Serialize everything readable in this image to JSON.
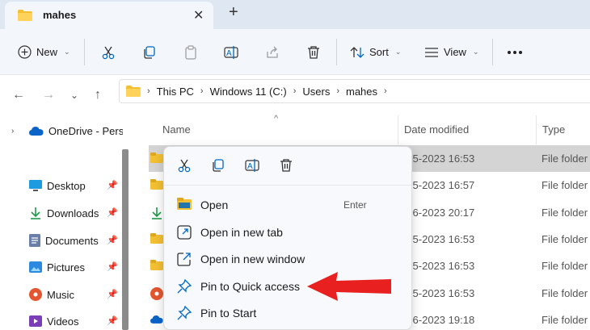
{
  "tab": {
    "title": "mahes",
    "close_icon": "close-icon",
    "new_tab_icon": "plus-icon"
  },
  "toolbar": {
    "new_label": "New",
    "sort_label": "Sort",
    "view_label": "View",
    "more_icon": "more-icon"
  },
  "address": {
    "crumbs": [
      "This PC",
      "Windows 11 (C:)",
      "Users",
      "mahes"
    ]
  },
  "sidebar": {
    "onedrive": "OneDrive - Perso",
    "items": [
      {
        "label": "Desktop",
        "icon": "desktop-icon"
      },
      {
        "label": "Downloads",
        "icon": "download-icon"
      },
      {
        "label": "Documents",
        "icon": "documents-icon"
      },
      {
        "label": "Pictures",
        "icon": "pictures-icon"
      },
      {
        "label": "Music",
        "icon": "music-icon"
      },
      {
        "label": "Videos",
        "icon": "videos-icon"
      }
    ]
  },
  "columns": {
    "name": "Name",
    "date": "Date modified",
    "type": "Type"
  },
  "rows": [
    {
      "date": "-05-2023 16:53",
      "type": "File folder"
    },
    {
      "date": "-05-2023 16:57",
      "type": "File folder"
    },
    {
      "date": "-06-2023 20:17",
      "type": "File folder"
    },
    {
      "date": "-05-2023 16:53",
      "type": "File folder"
    },
    {
      "date": "-05-2023 16:53",
      "type": "File folder"
    },
    {
      "date": "-05-2023 16:53",
      "type": "File folder"
    },
    {
      "date": "-06-2023 19:18",
      "type": "File folder"
    }
  ],
  "context_menu": {
    "items": [
      {
        "label": "Open",
        "shortcut": "Enter"
      },
      {
        "label": "Open in new tab",
        "shortcut": ""
      },
      {
        "label": "Open in new window",
        "shortcut": ""
      },
      {
        "label": "Pin to Quick access",
        "shortcut": ""
      },
      {
        "label": "Pin to Start",
        "shortcut": ""
      }
    ]
  },
  "colors": {
    "accent": "#0067c0",
    "folder": "#f4c033",
    "arrow": "#e8201f"
  }
}
